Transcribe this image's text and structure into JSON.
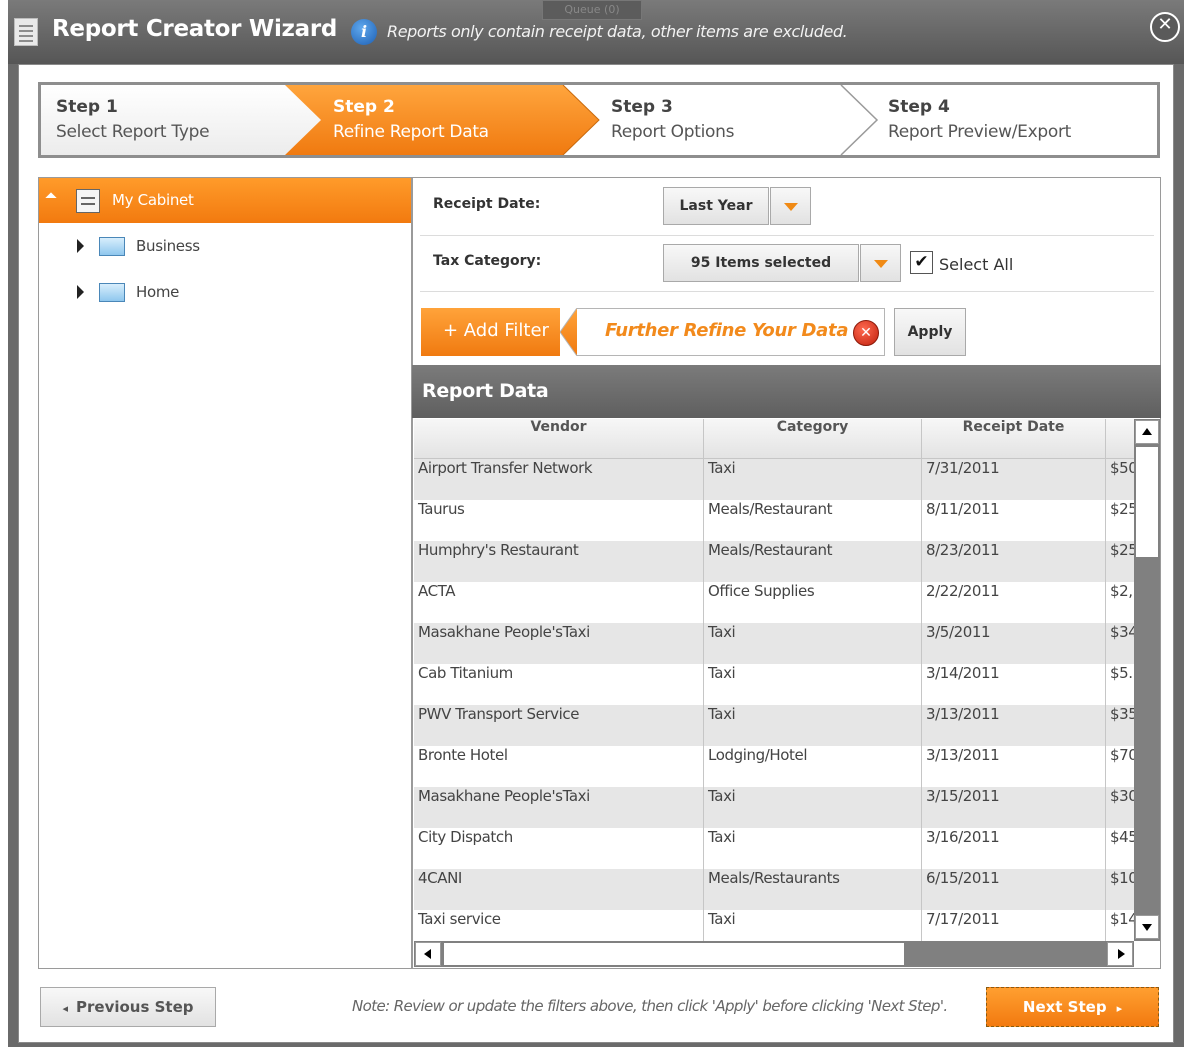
{
  "window": {
    "title": "Report Creator Wizard",
    "info_text": "Reports only contain receipt data, other items are excluded.",
    "background_tab": "Queue (0)"
  },
  "steps": [
    {
      "title": "Step 1",
      "label": "Select Report Type",
      "state": "done"
    },
    {
      "title": "Step 2",
      "label": "Refine Report Data",
      "state": "active"
    },
    {
      "title": "Step 3",
      "label": "Report Options",
      "state": "upcoming"
    },
    {
      "title": "Step 4",
      "label": "Report Preview/Export",
      "state": "upcoming"
    }
  ],
  "tree": {
    "root": "My Cabinet",
    "children": [
      "Business",
      "Home"
    ]
  },
  "filters": {
    "receipt_date_label": "Receipt Date:",
    "receipt_date_value": "Last Year",
    "tax_category_label": "Tax Category:",
    "tax_category_value": "95 Items selected",
    "select_all_label": "Select All",
    "select_all_checked": true,
    "add_filter_label": "+ Add Filter",
    "refine_text": "Further Refine Your Data",
    "apply_label": "Apply"
  },
  "report": {
    "title": "Report Data",
    "columns": [
      "Vendor",
      "Category",
      "Receipt Date"
    ],
    "rows": [
      {
        "vendor": "Airport Transfer Network",
        "category": "Taxi",
        "date": "7/31/2011",
        "amount": "$50"
      },
      {
        "vendor": "Taurus",
        "category": "Meals/Restaurant",
        "date": "8/11/2011",
        "amount": "$25"
      },
      {
        "vendor": "Humphry's Restaurant",
        "category": "Meals/Restaurant",
        "date": "8/23/2011",
        "amount": "$25"
      },
      {
        "vendor": "ACTA",
        "category": "Office Supplies",
        "date": "2/22/2011",
        "amount": "$2,"
      },
      {
        "vendor": "Masakhane People'sTaxi",
        "category": "Taxi",
        "date": "3/5/2011",
        "amount": "$34"
      },
      {
        "vendor": "Cab Titanium",
        "category": "Taxi",
        "date": "3/14/2011",
        "amount": "$5."
      },
      {
        "vendor": "PWV Transport Service",
        "category": "Taxi",
        "date": "3/13/2011",
        "amount": "$35"
      },
      {
        "vendor": "Bronte Hotel",
        "category": "Lodging/Hotel",
        "date": "3/13/2011",
        "amount": "$70"
      },
      {
        "vendor": "Masakhane People'sTaxi",
        "category": "Taxi",
        "date": "3/15/2011",
        "amount": "$30"
      },
      {
        "vendor": "City Dispatch",
        "category": "Taxi",
        "date": "3/16/2011",
        "amount": "$45"
      },
      {
        "vendor": "4CANI",
        "category": "Meals/Restaurants",
        "date": "6/15/2011",
        "amount": "$10"
      },
      {
        "vendor": "Taxi service",
        "category": "Taxi",
        "date": "7/17/2011",
        "amount": "$14"
      }
    ]
  },
  "footer": {
    "previous_label": "Previous Step",
    "note": "Note: Review or update the filters above, then click 'Apply' before clicking 'Next Step'.",
    "next_label": "Next Step"
  },
  "colors": {
    "accent": "#f28a1c",
    "header_gray": "#6b6b6b"
  }
}
